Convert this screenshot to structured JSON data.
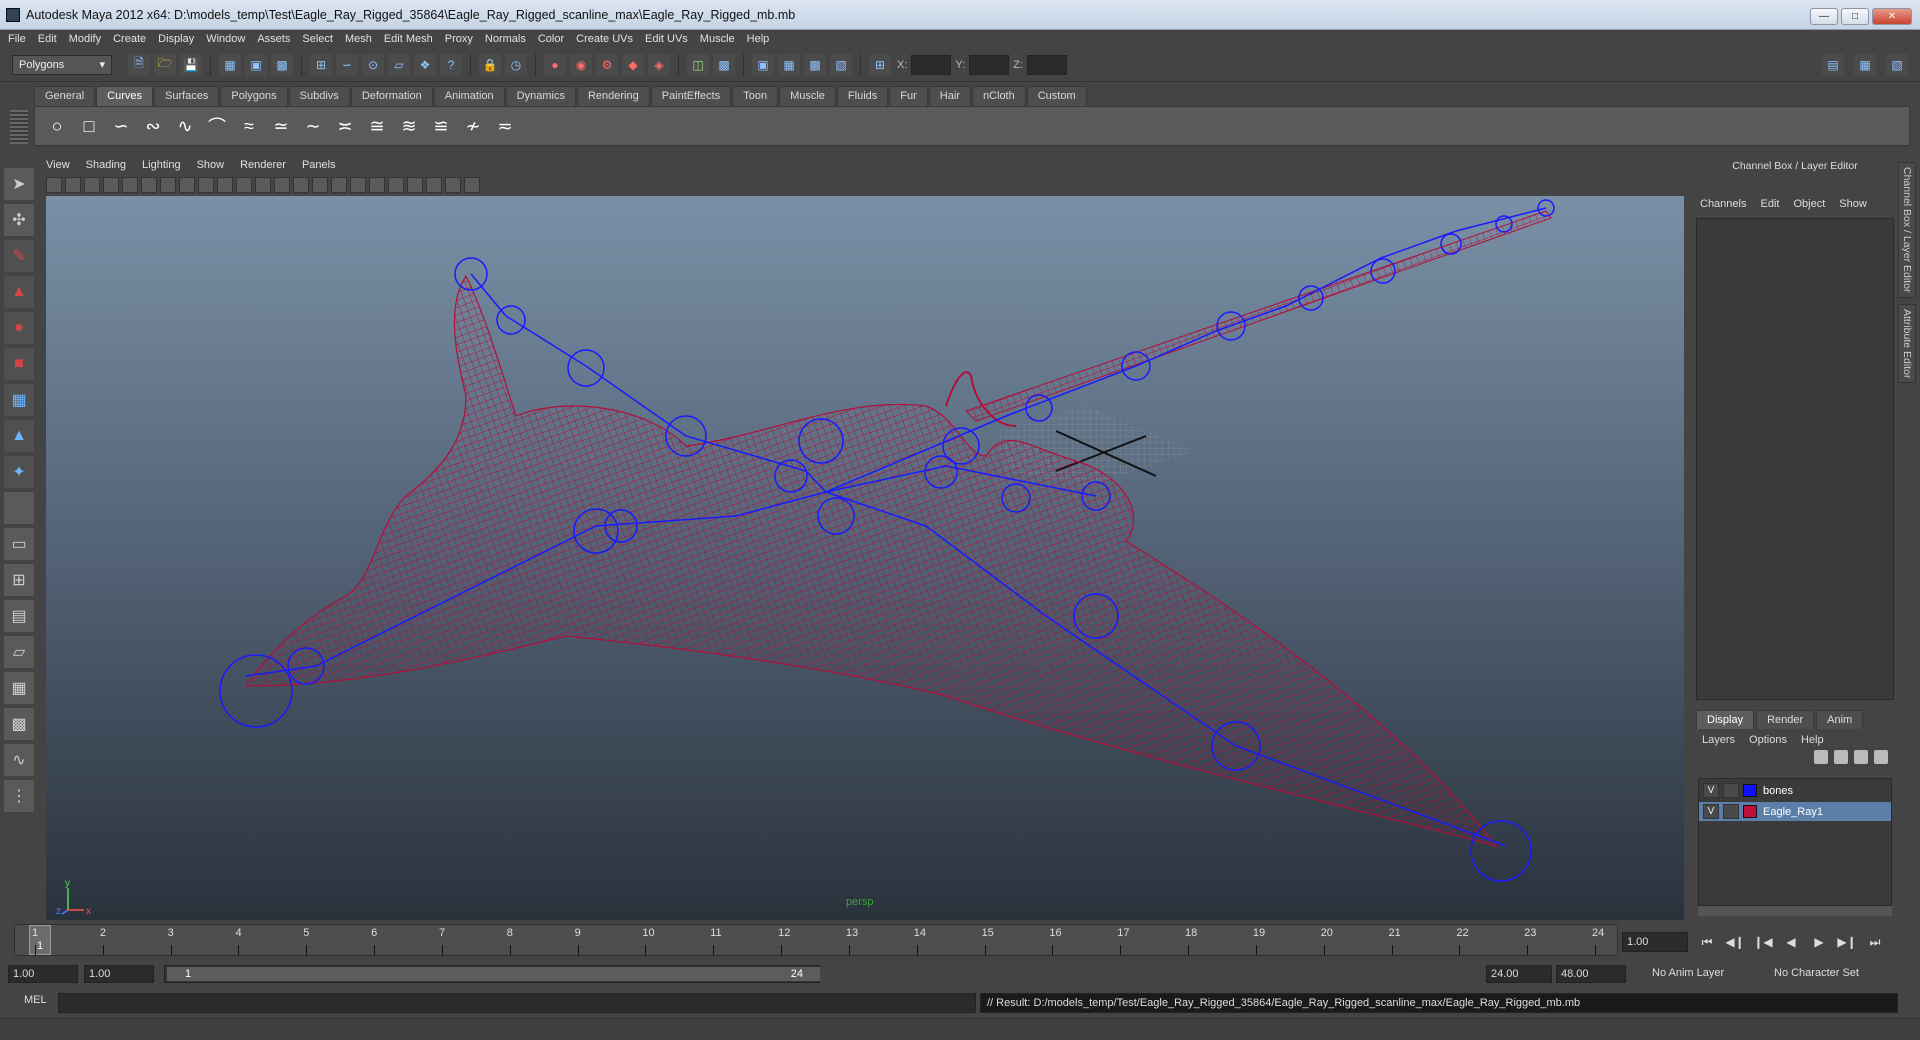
{
  "window": {
    "title": "Autodesk Maya 2012 x64: D:\\models_temp\\Test\\Eagle_Ray_Rigged_35864\\Eagle_Ray_Rigged_scanline_max\\Eagle_Ray_Rigged_mb.mb"
  },
  "menubar": [
    "File",
    "Edit",
    "Modify",
    "Create",
    "Display",
    "Window",
    "Assets",
    "Select",
    "Mesh",
    "Edit Mesh",
    "Proxy",
    "Normals",
    "Color",
    "Create UVs",
    "Edit UVs",
    "Muscle",
    "Help"
  ],
  "statusline": {
    "mode": "Polygons",
    "x_label": "X:",
    "y_label": "Y:",
    "z_label": "Z:"
  },
  "shelf": {
    "tabs": [
      "General",
      "Curves",
      "Surfaces",
      "Polygons",
      "Subdivs",
      "Deformation",
      "Animation",
      "Dynamics",
      "Rendering",
      "PaintEffects",
      "Toon",
      "Muscle",
      "Fluids",
      "Fur",
      "Hair",
      "nCloth",
      "Custom"
    ],
    "active": "Curves"
  },
  "panel": {
    "menu": [
      "View",
      "Shading",
      "Lighting",
      "Show",
      "Renderer",
      "Panels"
    ],
    "camera_label": "persp"
  },
  "channel_box": {
    "title": "Channel Box / Layer Editor",
    "menu": [
      "Channels",
      "Edit",
      "Object",
      "Show"
    ]
  },
  "side_tabs": [
    "Channel Box / Layer Editor",
    "Attribute Editor"
  ],
  "layers": {
    "tabs": [
      "Display",
      "Render",
      "Anim"
    ],
    "menu": [
      "Layers",
      "Options",
      "Help"
    ],
    "items": [
      {
        "visible": "V",
        "name": "bones",
        "color": "#1010ff",
        "selected": false
      },
      {
        "visible": "V",
        "name": "Eagle_Ray1",
        "color": "#c0103a",
        "selected": true
      }
    ]
  },
  "timeline": {
    "ticks": [
      "1",
      "2",
      "3",
      "4",
      "5",
      "6",
      "7",
      "8",
      "9",
      "10",
      "11",
      "12",
      "13",
      "14",
      "15",
      "16",
      "17",
      "18",
      "19",
      "20",
      "21",
      "22",
      "23",
      "24"
    ],
    "current": "1",
    "current_field": "1.00"
  },
  "range": {
    "start": "1.00",
    "start2": "1.00",
    "slider_start": "1",
    "slider_end": "24",
    "end": "24.00",
    "end2": "48.00",
    "anim_layer": "No Anim Layer",
    "char_set": "No Character Set"
  },
  "command": {
    "label": "MEL",
    "result": "// Result: D:/models_temp/Test/Eagle_Ray_Rigged_35864/Eagle_Ray_Rigged_scanline_max/Eagle_Ray_Rigged_mb.mb"
  },
  "colors": {
    "mesh": "#b0103a",
    "bones": "#1a1aff"
  }
}
